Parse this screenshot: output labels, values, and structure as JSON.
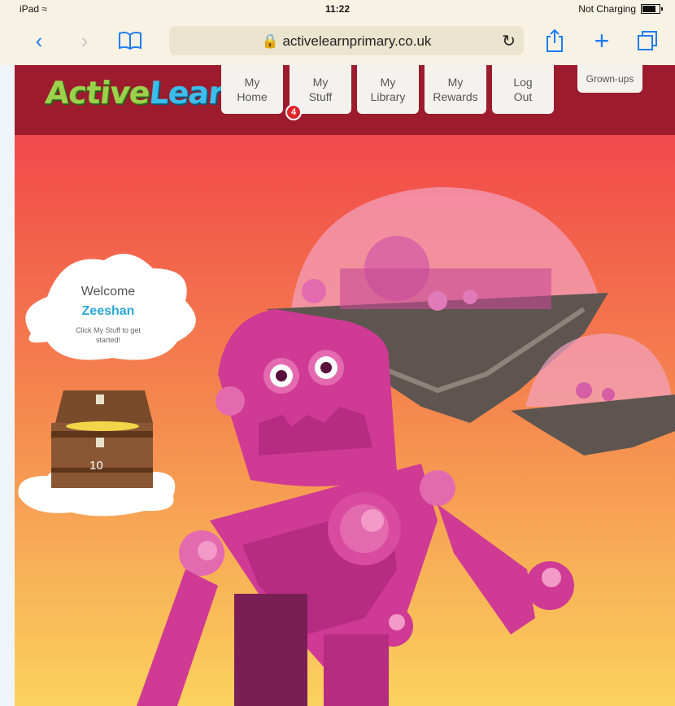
{
  "status_bar": {
    "device": "iPad",
    "time": "11:22",
    "battery_text": "Not Charging"
  },
  "browser": {
    "url": "activelearnprimary.co.uk"
  },
  "site": {
    "logo_active": "Active",
    "logo_learn": "Learn",
    "nav": [
      {
        "line1": "My",
        "line2": "Home"
      },
      {
        "line1": "My",
        "line2": "Stuff"
      },
      {
        "line1": "My",
        "line2": "Library"
      },
      {
        "line1": "My",
        "line2": "Rewards"
      },
      {
        "line1": "Log",
        "line2": "Out"
      }
    ],
    "stuff_badge": "4",
    "grownups": "Grown-ups"
  },
  "welcome": {
    "title": "Welcome",
    "name": "Zeeshan",
    "hint": "Click My Stuff to get started!"
  },
  "treasure": {
    "coins": "10"
  },
  "colors": {
    "header": "#9c1c2e",
    "accent_blue": "#1f7cf0",
    "name_blue": "#2aa8d8",
    "robot_pink": "#cf3a94"
  }
}
